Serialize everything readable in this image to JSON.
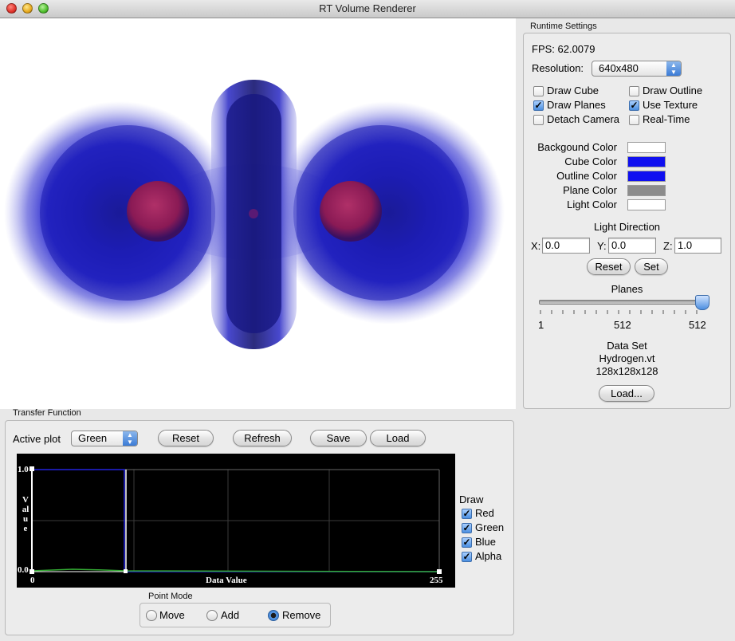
{
  "window": {
    "title": "RT Volume Renderer"
  },
  "runtime": {
    "group_label": "Runtime Settings",
    "fps_text": "FPS: 62.0079",
    "resolution_label": "Resolution:",
    "resolution_value": "640x480",
    "checkboxes": [
      {
        "label": "Draw Cube",
        "checked": false
      },
      {
        "label": "Draw Outline",
        "checked": false
      },
      {
        "label": "Draw Planes",
        "checked": true
      },
      {
        "label": "Use Texture",
        "checked": true
      },
      {
        "label": "Detach Camera",
        "checked": false
      },
      {
        "label": "Real-Time",
        "checked": false
      }
    ],
    "colors": [
      {
        "label": "Backgound Color",
        "value": "#ffffff"
      },
      {
        "label": "Cube Color",
        "value": "#1010f0"
      },
      {
        "label": "Outline Color",
        "value": "#1010f0"
      },
      {
        "label": "Plane Color",
        "value": "#8c8c8c"
      },
      {
        "label": "Light Color",
        "value": "#ffffff"
      }
    ],
    "light": {
      "title": "Light Direction",
      "x_label": "X:",
      "x_value": "0.0",
      "y_label": "Y:",
      "y_value": "0.0",
      "z_label": "Z:",
      "z_value": "1.0",
      "reset_label": "Reset",
      "set_label": "Set"
    },
    "planes": {
      "title": "Planes",
      "min_label": "1",
      "mid_label": "512",
      "max_label": "512",
      "level": 1.0
    },
    "dataset": {
      "title": "Data Set",
      "name": "Hydrogen.vt",
      "dims": "128x128x128",
      "load_label": "Load..."
    }
  },
  "transfer": {
    "group_label": "Transfer Function",
    "active_plot_label": "Active plot",
    "active_plot_value": "Green",
    "reset_label": "Reset",
    "refresh_label": "Refresh",
    "save_label": "Save",
    "load_label": "Load",
    "plot": {
      "y_max": "1.0",
      "y_min": "0.0",
      "x_min": "0",
      "x_max": "255",
      "xlabel": "Data Value",
      "ylabel": "Value"
    },
    "draw": {
      "title": "Draw",
      "items": [
        {
          "label": "Red",
          "checked": true
        },
        {
          "label": "Green",
          "checked": true
        },
        {
          "label": "Blue",
          "checked": true
        },
        {
          "label": "Alpha",
          "checked": true
        }
      ]
    },
    "point_mode": {
      "title": "Point Mode",
      "options": [
        {
          "label": "Move",
          "selected": false
        },
        {
          "label": "Add",
          "selected": false
        },
        {
          "label": "Remove",
          "selected": true
        }
      ]
    }
  }
}
